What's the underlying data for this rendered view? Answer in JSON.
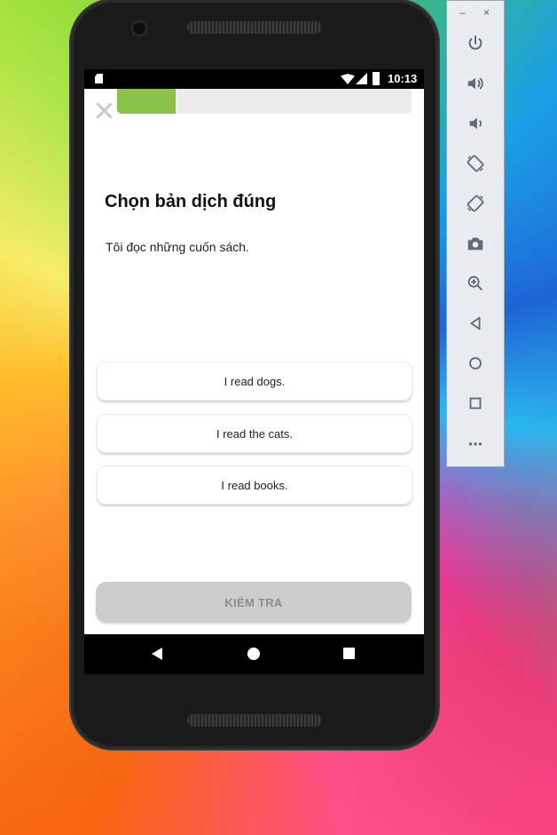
{
  "status_bar": {
    "time": "10:13"
  },
  "lesson": {
    "progress_fraction": 0.2,
    "title": "Chọn bản dịch đúng",
    "prompt": "Tôi đọc những cuốn sách.",
    "options": [
      "I read dogs.",
      "I read the cats.",
      "I read books."
    ],
    "check_label": "KIỂM TRA"
  },
  "emulator_toolbar": {
    "window_controls": {
      "minimize": "–",
      "close": "×"
    },
    "tools": [
      "power-icon",
      "volume-up-icon",
      "volume-down-icon",
      "rotate-left-icon",
      "rotate-right-icon",
      "camera-icon",
      "zoom-icon",
      "back-icon",
      "home-icon",
      "overview-icon",
      "more-icon"
    ]
  },
  "colors": {
    "progress": "#8bc34a",
    "check_button_disabled": "#cdcdcd"
  }
}
